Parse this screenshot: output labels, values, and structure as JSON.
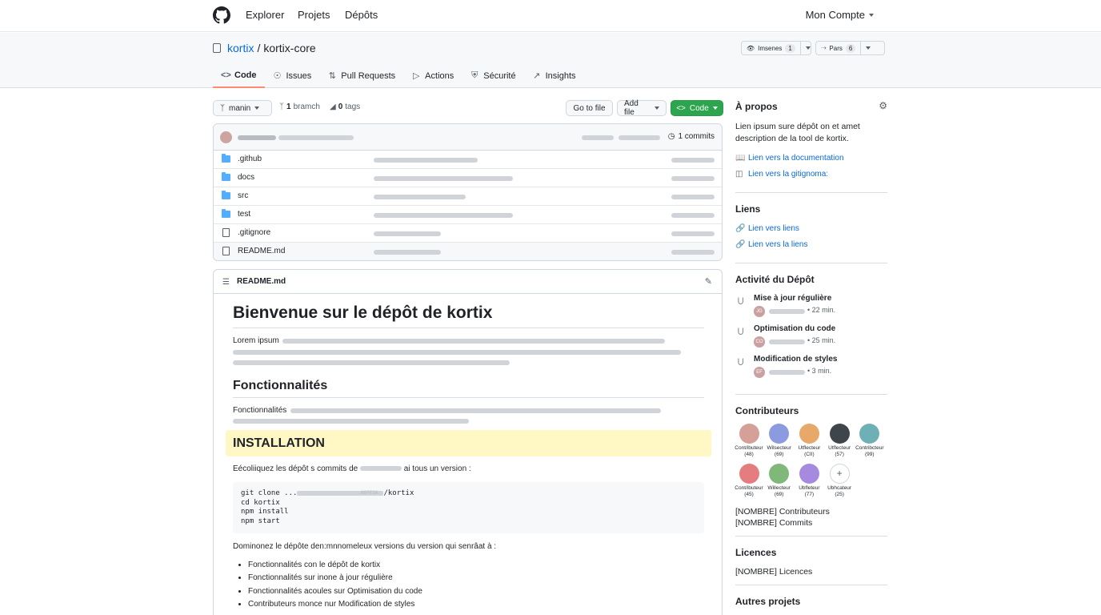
{
  "topnav": {
    "links": [
      "Explorer",
      "Projets",
      "Dépôts"
    ],
    "account": "Mon Compte"
  },
  "repo": {
    "owner": "kortix",
    "separator": "/",
    "name": "kortix-core",
    "watch": {
      "label": "Imsenes",
      "count": "1"
    },
    "fork": {
      "label": "Pars",
      "count": "6"
    }
  },
  "tabs": [
    "Code",
    "Issues",
    "Pull Requests",
    "Actions",
    "Sécurité",
    "Insights"
  ],
  "branchbar": {
    "branch": "manin",
    "branches_count": "1",
    "branches_label": "bramch",
    "tags_count": "0",
    "tags_label": "tags",
    "go_to_file": "Go to file",
    "add_file": "Add file",
    "code": "Code"
  },
  "files": {
    "commits": "1 commits",
    "items": [
      {
        "name": ".github",
        "type": "folder"
      },
      {
        "name": "docs",
        "type": "folder"
      },
      {
        "name": "src",
        "type": "folder"
      },
      {
        "name": "test",
        "type": "folder"
      },
      {
        "name": ".gitignore",
        "type": "file"
      },
      {
        "name": "README.md",
        "type": "file"
      }
    ]
  },
  "readme": {
    "filename": "README.md",
    "h1": "Bienvenue sur le dépôt de kortix",
    "intro_label": "Lorem ipsum",
    "h2_features": "Fonctionnalités",
    "features_label": "Fonctionnalités",
    "h2_install": "INSTALLATION",
    "install_text_a": "Eécoliiquez les dépôt s commits de",
    "install_text_b": "ai tous un version :",
    "code_lines": [
      "git clone ...",
      "cd kortix",
      "npm install",
      "npm start"
    ],
    "code_suffix": "/kortix",
    "code_fade": ".NOPESK",
    "after_code": "Dominonez le dépôte den:mnnomeleux versions du version qui senrâat à :",
    "bullets": [
      "Fonctionnalités con le dépôt de kortix",
      "Fonctionnalités sur inone à jour régulière",
      "Fonctionnalités acoules sur Optimisation du code",
      "Contributeurs monce nur Modification de styles"
    ]
  },
  "sidebar": {
    "about_title": "À propos",
    "about_text": "Lien ipsum sure dépôt on et amet description de la tool de kortix.",
    "about_links": [
      "Lien vers la documentation",
      "Lien vers la gitignoma:"
    ],
    "links_title": "Liens",
    "links": [
      "Lien vers liens",
      "Lien vers la liens"
    ],
    "activity_title": "Activité du Dépôt",
    "activity": [
      {
        "title": "Mise à jour régulière",
        "initials": "JG",
        "time": "• 22 min."
      },
      {
        "title": "Optimisation du code",
        "initials": "CO",
        "time": "• 25 min."
      },
      {
        "title": "Modification de styles",
        "initials": "EF",
        "time": "• 3 min."
      }
    ],
    "contributors_title": "Contributeurs",
    "contributors": [
      {
        "label": "Cont/ibuteur",
        "count": "(48)",
        "color": "#d4a097"
      },
      {
        "label": "Wilsecteur",
        "count": "(69)",
        "color": "#8c9be0"
      },
      {
        "label": "Utflecteur",
        "count": "(CII)",
        "color": "#e8a86a"
      },
      {
        "label": "Utflecteur",
        "count": "(57)",
        "color": "#3e454b"
      },
      {
        "label": "Contribcteur",
        "count": "(99)",
        "color": "#6fb0b7"
      },
      {
        "label": "Cont/ibuteur",
        "count": "(45)",
        "color": "#e57c80"
      },
      {
        "label": "Willecteur",
        "count": "(69)",
        "color": "#80b87a"
      },
      {
        "label": "Ubfleteur",
        "count": "(77)",
        "color": "#a68ae0"
      },
      {
        "label": "Ubhcateur",
        "count": "(25)",
        "color": "plus"
      }
    ],
    "contributors_count": "[NOMBRE] Contributeurs",
    "commits_count": "[NOMBRE] Commits",
    "licences_title": "Licences",
    "licences_count": "[NOMBRE] Licences",
    "other_title": "Autres projets"
  }
}
